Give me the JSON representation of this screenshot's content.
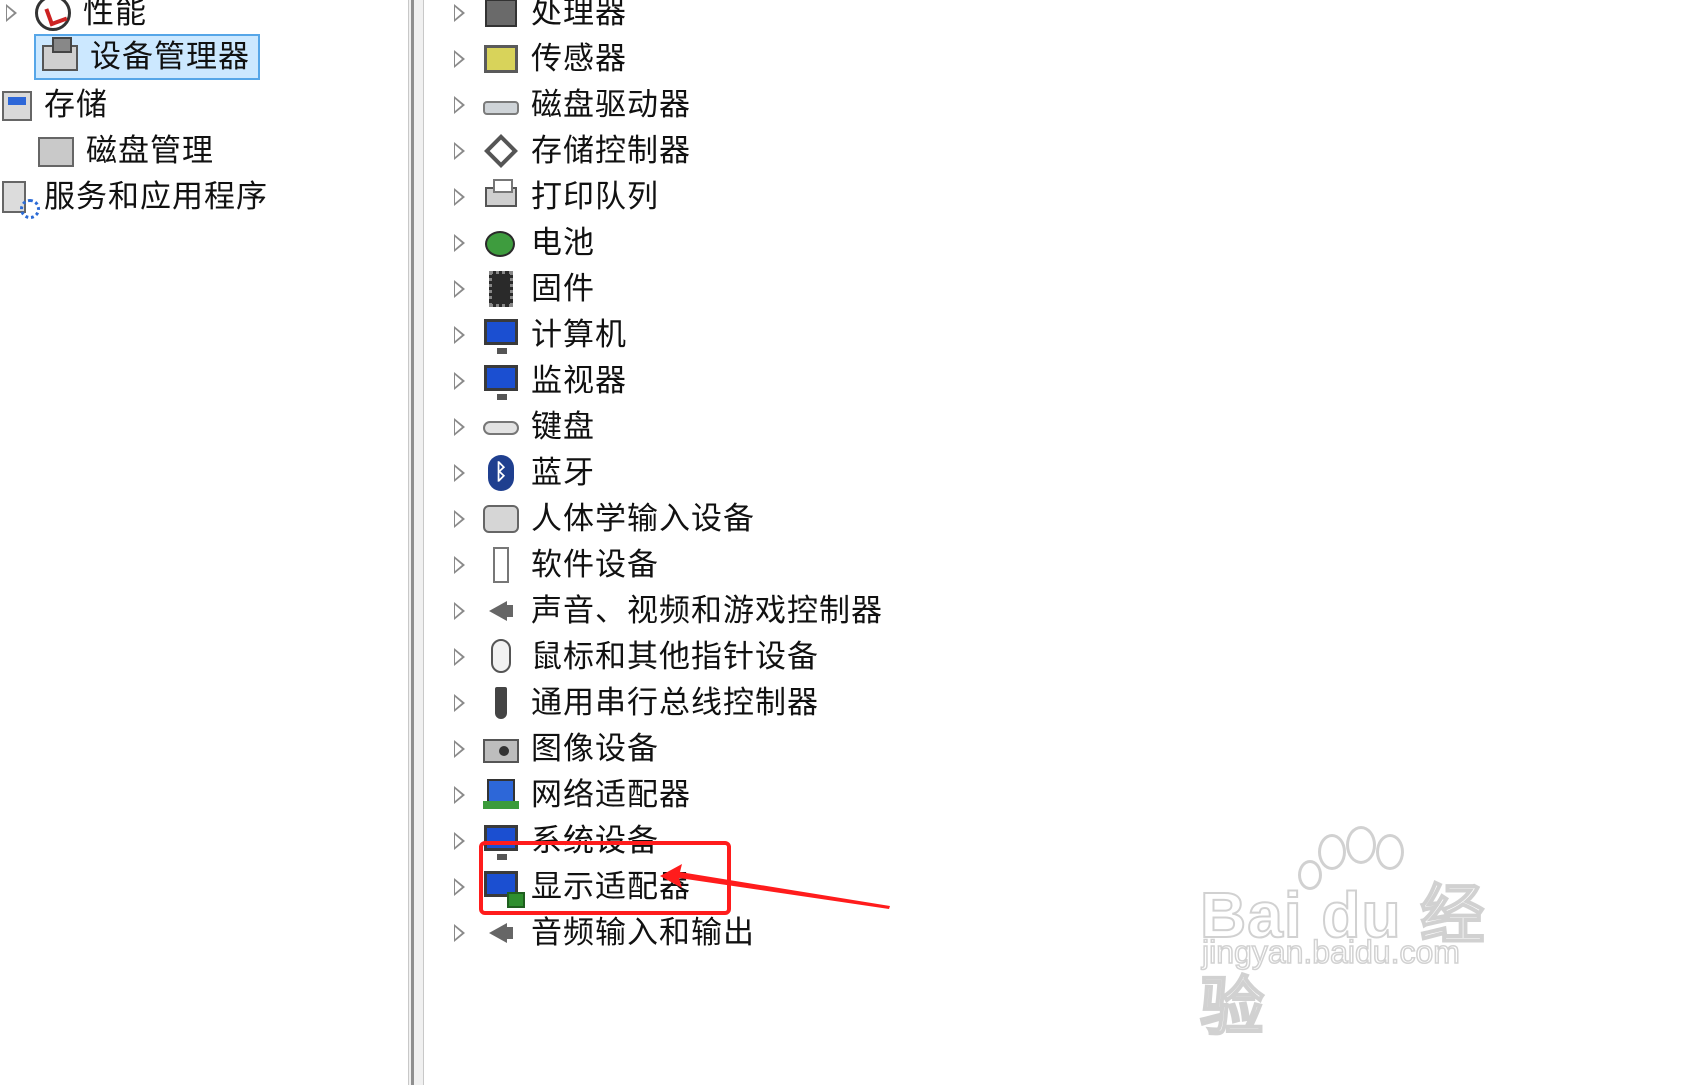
{
  "left_tree": [
    {
      "label": "性能",
      "icon": "performance-icon",
      "expandable": true
    },
    {
      "label": "设备管理器",
      "icon": "device-manager-icon",
      "selected": true
    },
    {
      "label": "存储",
      "icon": "storage-icon"
    },
    {
      "label": "磁盘管理",
      "icon": "disk-management-icon"
    },
    {
      "label": "服务和应用程序",
      "icon": "services-icon"
    }
  ],
  "device_categories": [
    {
      "label": "处理器",
      "icon": "processor-icon"
    },
    {
      "label": "传感器",
      "icon": "sensor-icon"
    },
    {
      "label": "磁盘驱动器",
      "icon": "disk-drive-icon"
    },
    {
      "label": "存储控制器",
      "icon": "storage-controller-icon"
    },
    {
      "label": "打印队列",
      "icon": "printer-icon"
    },
    {
      "label": "电池",
      "icon": "battery-icon"
    },
    {
      "label": "固件",
      "icon": "firmware-icon"
    },
    {
      "label": "计算机",
      "icon": "computer-icon"
    },
    {
      "label": "监视器",
      "icon": "monitor-icon"
    },
    {
      "label": "键盘",
      "icon": "keyboard-icon"
    },
    {
      "label": "蓝牙",
      "icon": "bluetooth-icon"
    },
    {
      "label": "人体学输入设备",
      "icon": "hid-icon"
    },
    {
      "label": "软件设备",
      "icon": "software-device-icon"
    },
    {
      "label": "声音、视频和游戏控制器",
      "icon": "speaker-icon"
    },
    {
      "label": "鼠标和其他指针设备",
      "icon": "mouse-icon"
    },
    {
      "label": "通用串行总线控制器",
      "icon": "usb-icon"
    },
    {
      "label": "图像设备",
      "icon": "camera-icon"
    },
    {
      "label": "网络适配器",
      "icon": "network-adapter-icon"
    },
    {
      "label": "系统设备",
      "icon": "system-device-icon"
    },
    {
      "label": "显示适配器",
      "icon": "display-adapter-icon",
      "annotated": true
    },
    {
      "label": "音频输入和输出",
      "icon": "audio-io-icon"
    }
  ],
  "colors": {
    "annotation": "#ff1c1c",
    "selection_bg": "#cce8ff",
    "selection_border": "#56a6e8"
  },
  "watermark": {
    "brand": "Bai du 经验",
    "url": "jingyan.baidu.com"
  }
}
